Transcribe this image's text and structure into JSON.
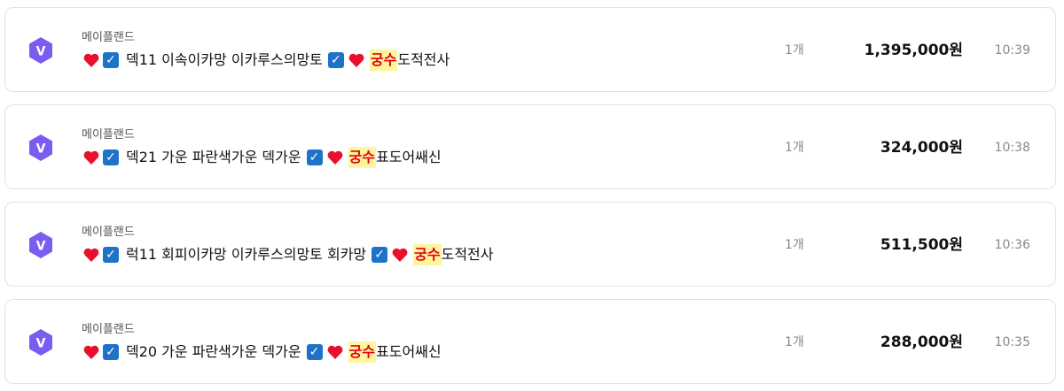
{
  "listings": [
    {
      "server": "메이플랜드",
      "item_name": "덱11 이속이카망 이카루스의망토",
      "highlight": "궁수",
      "job": "도적전사",
      "quantity": "1개",
      "price": "1,395,000원",
      "time": "10:39"
    },
    {
      "server": "메이플랜드",
      "item_name": "덱21 가운 파란색가운 덱가운",
      "highlight": "궁수",
      "job": "표도어쌔신",
      "quantity": "1개",
      "price": "324,000원",
      "time": "10:38"
    },
    {
      "server": "메이플랜드",
      "item_name": "럭11 회피이카망 이카루스의망토 회카망",
      "highlight": "궁수",
      "job": "도적전사",
      "quantity": "1개",
      "price": "511,500원",
      "time": "10:36"
    },
    {
      "server": "메이플랜드",
      "item_name": "덱20 가운 파란색가운 덱가운",
      "highlight": "궁수",
      "job": "표도어쌔신",
      "quantity": "1개",
      "price": "288,000원",
      "time": "10:35"
    }
  ],
  "icons": {
    "logo": "maple-v-hexagon-icon",
    "heart": "red-heart-icon",
    "check": "check-box-icon"
  },
  "colors": {
    "logo": "#7b5cf0",
    "highlight_bg": "#fff59a",
    "highlight_text": "#e3001b",
    "check": "#1e73c8"
  }
}
